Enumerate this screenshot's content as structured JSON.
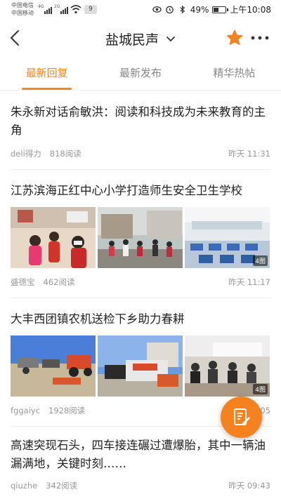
{
  "status_bar": {
    "carrier_1": "中国电信",
    "carrier_2": "中国移动",
    "net_1": "4G",
    "net_2": "2G",
    "notif_count": "9",
    "battery": "49%",
    "battery_level": 0.49,
    "time": "上午10:08",
    "icons": [
      "eye-icon",
      "alarm-icon",
      "bluetooth-icon",
      "battery-icon"
    ]
  },
  "nav": {
    "title": "盐城民声",
    "accent": "#f5891f"
  },
  "tabs": [
    {
      "label": "最新回复",
      "active": true
    },
    {
      "label": "最新发布",
      "active": false
    },
    {
      "label": "精华热帖",
      "active": false
    }
  ],
  "posts": [
    {
      "title": "朱永新对话俞敏洪：阅读和科技成为未来教育的主角",
      "author": "deli得力",
      "views": "818阅读",
      "time": "昨天 11:31"
    },
    {
      "title": "江苏滨海正红中心小学打造师生安全卫生学校",
      "author": "盛德宝",
      "views": "462阅读",
      "time": "昨天 11:17",
      "image_count": "4图"
    },
    {
      "title": "大丰西团镇农机送检下乡助力春耕",
      "author": "fggaiyc",
      "views": "1928阅读",
      "time": "05",
      "image_count": "4图"
    },
    {
      "title": "高速突现石头，四车接连碾过遭爆胎，其中一辆油漏满地，关键时刻……",
      "author": "qiuzhe",
      "views": "342阅读",
      "time": "昨天 09:43"
    }
  ]
}
